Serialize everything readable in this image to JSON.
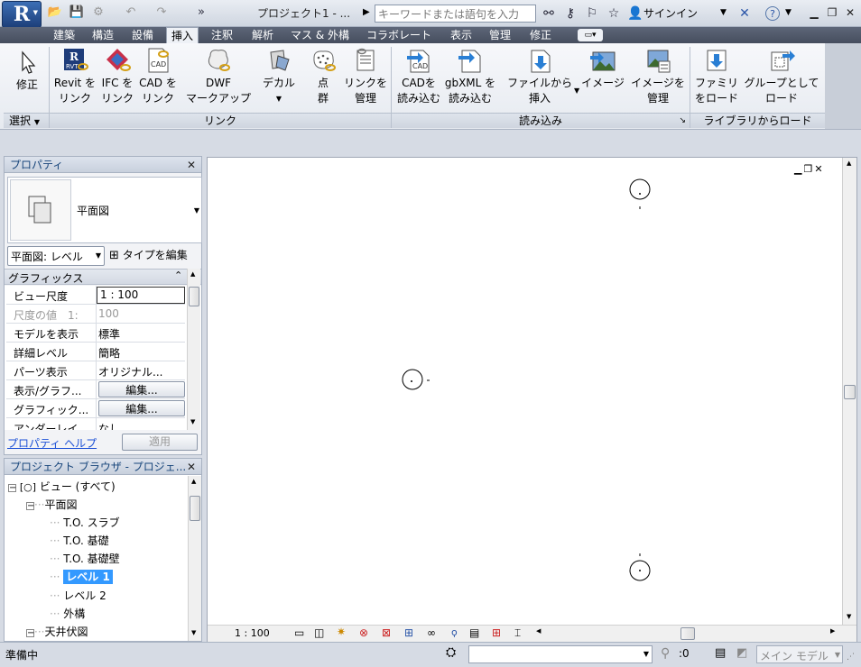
{
  "title_bar": {
    "app_logo": "R",
    "doc_title": "プロジェクト1 - ...",
    "search_placeholder": "キーワードまたは語句を入力",
    "signin": "サインイン"
  },
  "tabs": [
    "建築",
    "構造",
    "設備",
    "挿入",
    "注釈",
    "解析",
    "マス & 外構",
    "コラボレート",
    "表示",
    "管理",
    "修正"
  ],
  "active_tab": "挿入",
  "ribbon": {
    "modify": {
      "label_line1": "修正",
      "panel": "選択"
    },
    "buttons": [
      {
        "l1": "Revit を",
        "l2": "リンク",
        "icon": "revit-link-icon"
      },
      {
        "l1": "IFC を",
        "l2": "リンク",
        "icon": "ifc-link-icon"
      },
      {
        "l1": "CAD を",
        "l2": "リンク",
        "icon": "cad-link-icon"
      },
      {
        "l1": "DWF",
        "l2": "マークアップ",
        "icon": "dwf-markup-icon"
      },
      {
        "l1": "デカル",
        "l2": "",
        "icon": "decal-icon"
      },
      {
        "l1": "点",
        "l2": "群",
        "icon": "point-cloud-icon"
      },
      {
        "l1": "リンクを",
        "l2": "管理",
        "icon": "manage-links-icon"
      },
      {
        "l1": "CADを",
        "l2": "読み込む",
        "icon": "import-cad-icon"
      },
      {
        "l1": "gbXML を",
        "l2": "読み込む",
        "icon": "import-gbxml-icon"
      },
      {
        "l1": "ファイルから",
        "l2": "挿入",
        "icon": "insert-from-file-icon"
      },
      {
        "l1": "イメージ",
        "l2": "",
        "icon": "image-icon"
      },
      {
        "l1": "イメージを",
        "l2": "管理",
        "icon": "manage-images-icon"
      },
      {
        "l1": "ファミリ",
        "l2": "をロード",
        "icon": "load-family-icon"
      },
      {
        "l1": "グループとして",
        "l2": "ロード",
        "icon": "load-as-group-icon"
      }
    ],
    "panels": [
      "リンク",
      "読み込み",
      "ライブラリからロード"
    ],
    "cad_tag": "CAD",
    "rvt_tag": "RVT"
  },
  "properties": {
    "title": "プロパティ",
    "type_name": "平面図",
    "view_selector": "平面図: レベル",
    "edit_type": "タイプを編集",
    "section": "グラフィックス",
    "rows": [
      {
        "k": "ビュー尺度",
        "v": "1 : 100"
      },
      {
        "k": "尺度の値　1:",
        "v": "100"
      },
      {
        "k": "モデルを表示",
        "v": "標準"
      },
      {
        "k": "詳細レベル",
        "v": "簡略"
      },
      {
        "k": "パーツ表示",
        "v": "オリジナル..."
      },
      {
        "k": "表示/グラフ...",
        "v": "編集..."
      },
      {
        "k": "グラフィック...",
        "v": "編集..."
      },
      {
        "k": "アンダーレイ",
        "v": "なし"
      }
    ],
    "help_link": "プロパティ ヘルプ",
    "apply": "適用"
  },
  "browser": {
    "title": "プロジェクト ブラウザ - プロジェ...",
    "root": "ビュー (すべて)",
    "floor_plans": "平面図",
    "items": [
      "T.O. スラブ",
      "T.O. 基礎",
      "T.O. 基礎壁",
      "レベル 1",
      "レベル 2",
      "外構"
    ],
    "selected": "レベル 1",
    "ceiling": "天井伏図"
  },
  "canvas": {
    "scale": "1 : 100"
  },
  "status": {
    "text": "準備中",
    "counter": ":0",
    "model": "メイン モデル"
  }
}
